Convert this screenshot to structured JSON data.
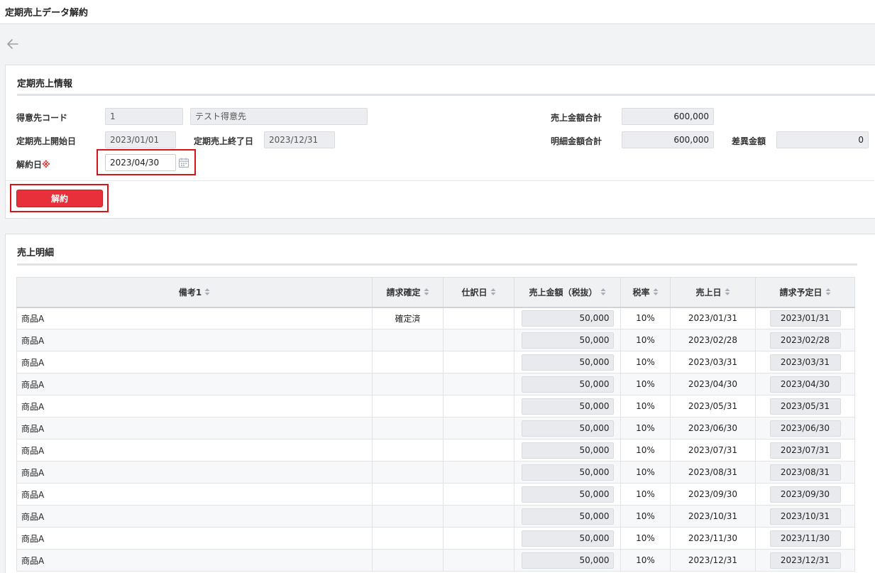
{
  "page": {
    "title": "定期売上データ解約"
  },
  "colors": {
    "accent_red": "#e8303a",
    "highlight": "#d7141a",
    "required": "#e03030",
    "readonly_bg": "#ecedf0"
  },
  "header_section": {
    "title": "定期売上情報",
    "customer_code_label": "得意先コード",
    "customer_code": "1",
    "customer_name": "テスト得意先",
    "start_date_label": "定期売上開始日",
    "start_date": "2023/01/01",
    "end_date_label": "定期売上終了日",
    "end_date": "2023/12/31",
    "cancel_date_label": "解約日",
    "required_mark": "※",
    "cancel_date": "2023/04/30",
    "sales_total_label": "売上金額合計",
    "sales_total": "600,000",
    "detail_total_label": "明細金額合計",
    "detail_total": "600,000",
    "diff_label": "差異金額",
    "diff": "0",
    "cancel_button": "解約"
  },
  "detail_section": {
    "title": "売上明細",
    "columns": [
      "備考1",
      "請求確定",
      "仕訳日",
      "売上金額（税抜）",
      "税率",
      "売上日",
      "請求予定日"
    ],
    "rows": [
      {
        "note": "商品A",
        "confirmed": "確定済",
        "journal_date": "",
        "amount": "50,000",
        "tax_rate": "10%",
        "sales_date": "2023/01/31",
        "billing_date": "2023/01/31"
      },
      {
        "note": "商品A",
        "confirmed": "",
        "journal_date": "",
        "amount": "50,000",
        "tax_rate": "10%",
        "sales_date": "2023/02/28",
        "billing_date": "2023/02/28"
      },
      {
        "note": "商品A",
        "confirmed": "",
        "journal_date": "",
        "amount": "50,000",
        "tax_rate": "10%",
        "sales_date": "2023/03/31",
        "billing_date": "2023/03/31"
      },
      {
        "note": "商品A",
        "confirmed": "",
        "journal_date": "",
        "amount": "50,000",
        "tax_rate": "10%",
        "sales_date": "2023/04/30",
        "billing_date": "2023/04/30"
      },
      {
        "note": "商品A",
        "confirmed": "",
        "journal_date": "",
        "amount": "50,000",
        "tax_rate": "10%",
        "sales_date": "2023/05/31",
        "billing_date": "2023/05/31"
      },
      {
        "note": "商品A",
        "confirmed": "",
        "journal_date": "",
        "amount": "50,000",
        "tax_rate": "10%",
        "sales_date": "2023/06/30",
        "billing_date": "2023/06/30"
      },
      {
        "note": "商品A",
        "confirmed": "",
        "journal_date": "",
        "amount": "50,000",
        "tax_rate": "10%",
        "sales_date": "2023/07/31",
        "billing_date": "2023/07/31"
      },
      {
        "note": "商品A",
        "confirmed": "",
        "journal_date": "",
        "amount": "50,000",
        "tax_rate": "10%",
        "sales_date": "2023/08/31",
        "billing_date": "2023/08/31"
      },
      {
        "note": "商品A",
        "confirmed": "",
        "journal_date": "",
        "amount": "50,000",
        "tax_rate": "10%",
        "sales_date": "2023/09/30",
        "billing_date": "2023/09/30"
      },
      {
        "note": "商品A",
        "confirmed": "",
        "journal_date": "",
        "amount": "50,000",
        "tax_rate": "10%",
        "sales_date": "2023/10/31",
        "billing_date": "2023/10/31"
      },
      {
        "note": "商品A",
        "confirmed": "",
        "journal_date": "",
        "amount": "50,000",
        "tax_rate": "10%",
        "sales_date": "2023/11/30",
        "billing_date": "2023/11/30"
      },
      {
        "note": "商品A",
        "confirmed": "",
        "journal_date": "",
        "amount": "50,000",
        "tax_rate": "10%",
        "sales_date": "2023/12/31",
        "billing_date": "2023/12/31"
      }
    ]
  }
}
